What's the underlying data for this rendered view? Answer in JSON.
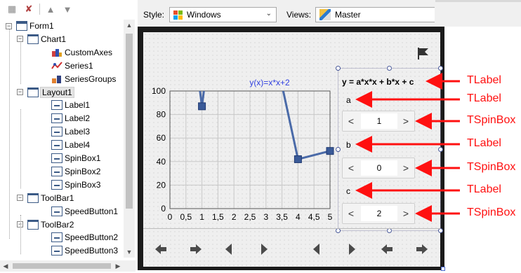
{
  "tree": {
    "nodes": [
      {
        "label": "Form1",
        "kind": "form",
        "level": 0,
        "expanded": true
      },
      {
        "label": "Chart1",
        "kind": "comp",
        "level": 1,
        "expanded": true
      },
      {
        "label": "CustomAxes",
        "kind": "axes",
        "level": 2
      },
      {
        "label": "Series1",
        "kind": "series",
        "level": 2
      },
      {
        "label": "SeriesGroups",
        "kind": "groups",
        "level": 2
      },
      {
        "label": "Layout1",
        "kind": "comp",
        "level": 1,
        "expanded": true,
        "selected": true
      },
      {
        "label": "Label1",
        "kind": "label",
        "level": 2
      },
      {
        "label": "Label2",
        "kind": "label",
        "level": 2
      },
      {
        "label": "Label3",
        "kind": "label",
        "level": 2
      },
      {
        "label": "Label4",
        "kind": "label",
        "level": 2
      },
      {
        "label": "SpinBox1",
        "kind": "label",
        "level": 2
      },
      {
        "label": "SpinBox2",
        "kind": "label",
        "level": 2
      },
      {
        "label": "SpinBox3",
        "kind": "label",
        "level": 2
      },
      {
        "label": "ToolBar1",
        "kind": "comp",
        "level": 1,
        "expanded": true
      },
      {
        "label": "SpeedButton1",
        "kind": "label",
        "level": 2
      },
      {
        "label": "ToolBar2",
        "kind": "comp",
        "level": 1,
        "expanded": true
      },
      {
        "label": "SpeedButton2",
        "kind": "label",
        "level": 2
      },
      {
        "label": "SpeedButton3",
        "kind": "label",
        "level": 2
      }
    ]
  },
  "topbar": {
    "style_label": "Style:",
    "style_value": "Windows",
    "views_label": "Views:",
    "views_value": "Master"
  },
  "chart_data": {
    "type": "line",
    "title": "y(x)=x*x+2",
    "x": [
      1,
      4,
      5
    ],
    "y": [
      87,
      42,
      49
    ],
    "xlim": [
      0,
      5
    ],
    "ylim": [
      0,
      100
    ],
    "xticks": [
      "0",
      "0,5",
      "1",
      "1,5",
      "2",
      "2,5",
      "3",
      "3,5",
      "4",
      "4,5",
      "5"
    ],
    "yticks": [
      "0",
      "20",
      "40",
      "60",
      "80",
      "100"
    ],
    "grid": true,
    "line_color": "#4a6aa8",
    "marker_color": "#3a5a98",
    "title_color": "#3040e0"
  },
  "layout_panel": {
    "formula": "y = a*x*x + b*x + c",
    "label_a": "a",
    "label_b": "b",
    "label_c": "c",
    "spin_a": "1",
    "spin_b": "0",
    "spin_c": "2",
    "minus_glyph": "<",
    "plus_glyph": ">"
  },
  "annotations": {
    "labels": [
      "TLabel",
      "TLabel",
      "TSpinBox",
      "TLabel",
      "TSpinBox",
      "TLabel",
      "TSpinBox"
    ],
    "color": "#ff1010"
  },
  "nav_buttons": [
    "left-arrow",
    "right-arrow",
    "left-triangle",
    "right-triangle",
    "left-triangle",
    "right-triangle",
    "left-arrow",
    "right-arrow"
  ]
}
